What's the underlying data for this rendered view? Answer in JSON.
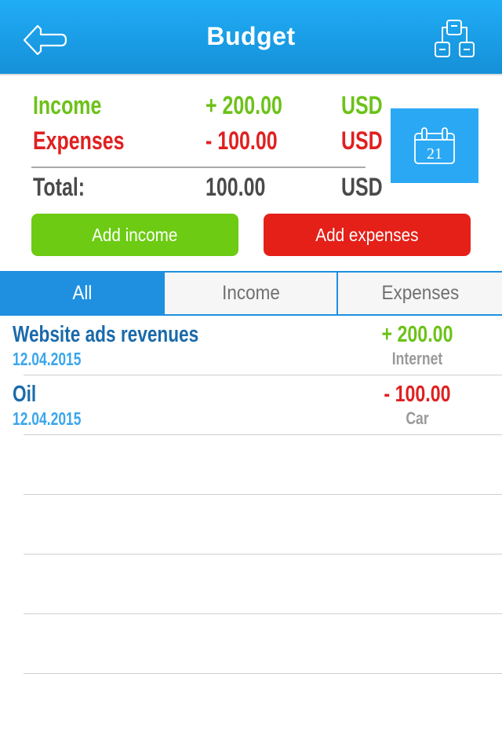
{
  "navbar": {
    "title": "Budget",
    "back_icon": "back-arrow-icon",
    "right_icon": "hierarchy-icon"
  },
  "summary": {
    "income": {
      "label": "Income",
      "amount": "+ 200.00",
      "currency": "USD"
    },
    "expenses": {
      "label": "Expenses",
      "amount": "- 100.00",
      "currency": "USD"
    },
    "total": {
      "label": "Total:",
      "amount": "100.00",
      "currency": "USD"
    },
    "calendar_icon": "calendar-icon",
    "calendar_day": "21"
  },
  "buttons": {
    "add_income": "Add income",
    "add_expenses": "Add expenses"
  },
  "tabs": [
    {
      "label": "All",
      "active": true
    },
    {
      "label": "Income",
      "active": false
    },
    {
      "label": "Expenses",
      "active": false
    }
  ],
  "transactions": [
    {
      "title": "Website ads revenues",
      "date": "12.04.2015",
      "amount": "+ 200.00",
      "category": "Internet",
      "type": "income"
    },
    {
      "title": "Oil",
      "date": "12.04.2015",
      "amount": "- 100.00",
      "category": "Car",
      "type": "expense"
    }
  ],
  "colors": {
    "primary": "#1f8fe0",
    "income": "#6cc218",
    "expense": "#e02020",
    "income_button": "#6ccb12",
    "expense_button": "#e42019"
  }
}
